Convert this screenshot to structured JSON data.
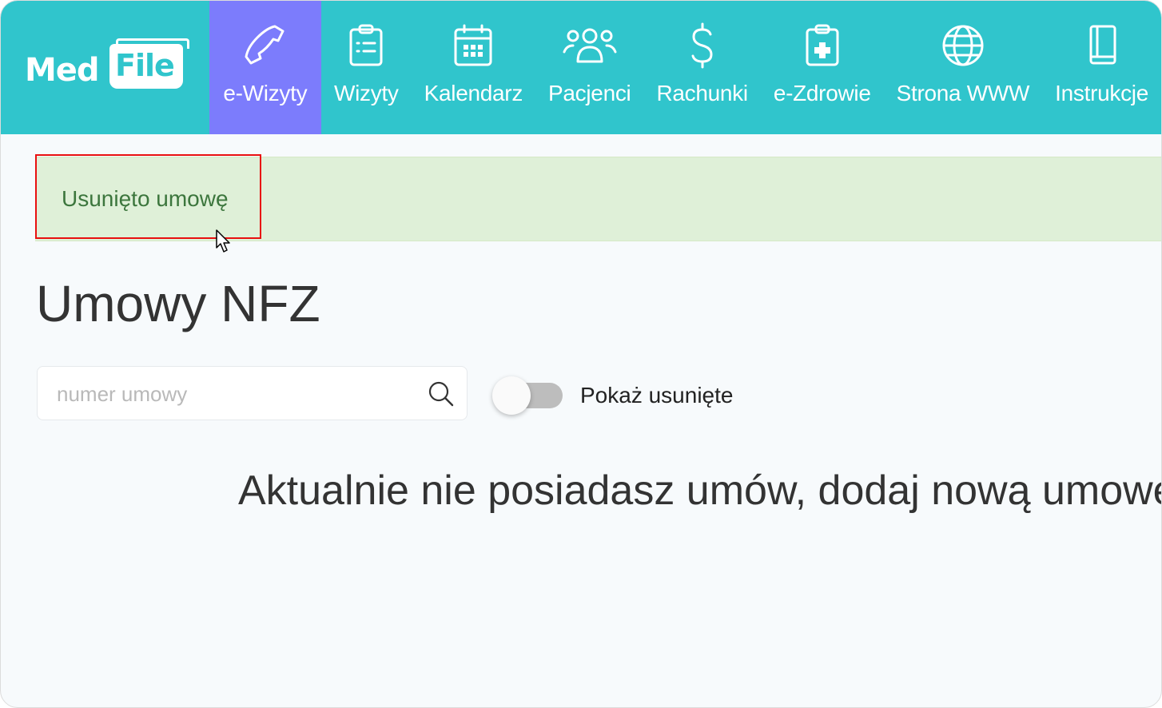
{
  "app": {
    "logo": {
      "part1": "Med",
      "part2": "File"
    }
  },
  "nav": {
    "items": [
      {
        "label": "e-Wizyty",
        "icon": "phone-icon",
        "active": true
      },
      {
        "label": "Wizyty",
        "icon": "clipboard-list-icon",
        "active": false
      },
      {
        "label": "Kalendarz",
        "icon": "calendar-icon",
        "active": false
      },
      {
        "label": "Pacjenci",
        "icon": "users-icon",
        "active": false
      },
      {
        "label": "Rachunki",
        "icon": "dollar-icon",
        "active": false
      },
      {
        "label": "e-Zdrowie",
        "icon": "clipboard-medical-icon",
        "active": false
      },
      {
        "label": "Strona WWW",
        "icon": "globe-icon",
        "active": false
      },
      {
        "label": "Instrukcje",
        "icon": "book-icon",
        "active": false
      }
    ],
    "colors": {
      "bar": "#30c5cc",
      "active": "#7c7cfc"
    }
  },
  "alert": {
    "message": "Usunięto umowę",
    "type": "success"
  },
  "page": {
    "title": "Umowy NFZ",
    "search": {
      "placeholder": "numer umowy",
      "value": ""
    },
    "toggle": {
      "label": "Pokaż usunięte",
      "checked": false
    },
    "empty_message": "Aktualnie nie posiadasz umów, dodaj nową umowę"
  }
}
